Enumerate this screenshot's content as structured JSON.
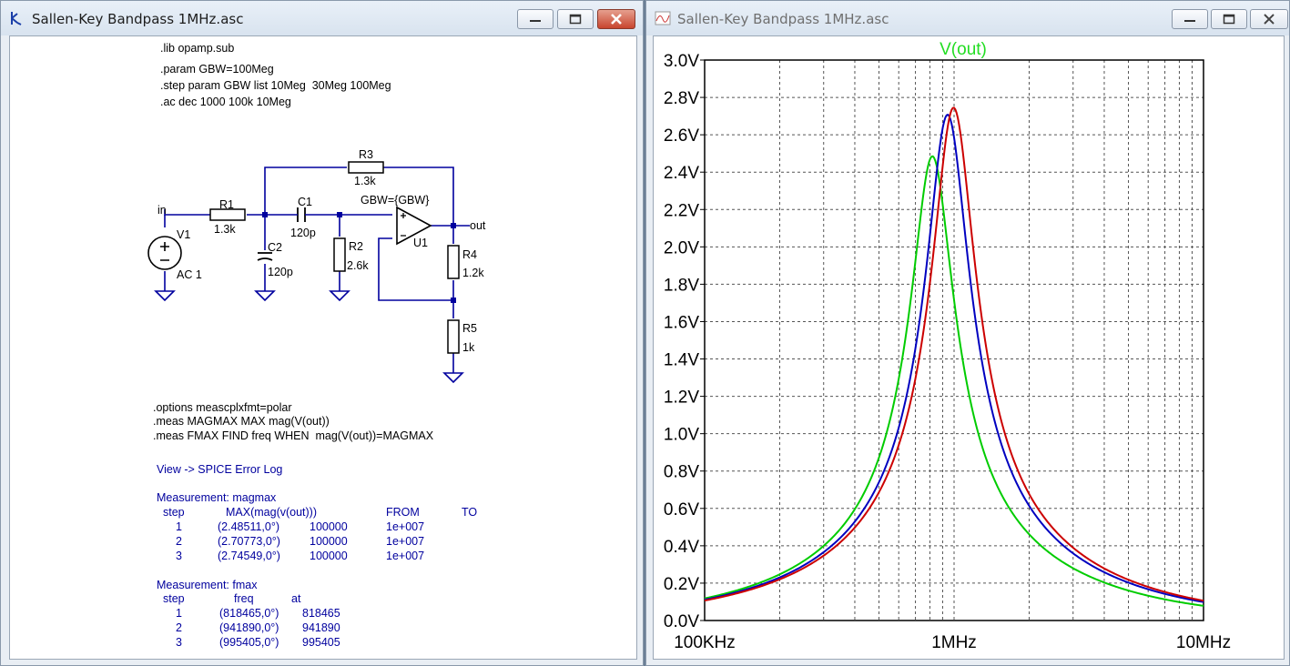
{
  "left_window": {
    "title": "Sallen-Key Bandpass 1MHz.asc",
    "directives": [
      ".lib opamp.sub",
      ".param GBW=100Meg",
      ".step param GBW list 10Meg  30Meg 100Meg",
      ".ac dec 1000 100k 10Meg"
    ],
    "components": {
      "r1_name": "R1",
      "r1_value": "1.3k",
      "r2_name": "R2",
      "r2_value": "2.6k",
      "r3_name": "R3",
      "r3_value": "1.3k",
      "r4_name": "R4",
      "r4_value": "1.2k",
      "r5_name": "R5",
      "r5_value": "1k",
      "c1_name": "C1",
      "c1_value": "120p",
      "c2_name": "C2",
      "c2_value": "120p",
      "v1_name": "V1",
      "v1_value": "AC 1",
      "u1_name": "U1",
      "u1_param": "GBW={GBW}",
      "in_label": "in",
      "out_label": "out"
    },
    "meas_directives": [
      ".options meascplxfmt=polar",
      ".meas MAGMAX MAX mag(V(out))",
      ".meas FMAX FIND freq WHEN  mag(V(out))=MAGMAX"
    ],
    "error_log_link": "View -> SPICE Error Log",
    "magmax": {
      "heading": "Measurement: magmax",
      "columns": [
        "step",
        "MAX(mag(v(out)))",
        "FROM",
        "TO"
      ],
      "rows": [
        [
          "1",
          "(2.48511,0°)",
          "100000",
          "1e+007"
        ],
        [
          "2",
          "(2.70773,0°)",
          "100000",
          "1e+007"
        ],
        [
          "3",
          "(2.74549,0°)",
          "100000",
          "1e+007"
        ]
      ]
    },
    "fmax": {
      "heading": "Measurement: fmax",
      "columns": [
        "step",
        "freq",
        "at"
      ],
      "rows": [
        [
          "1",
          "(818465,0°)",
          "818465"
        ],
        [
          "2",
          "(941890,0°)",
          "941890"
        ],
        [
          "3",
          "(995405,0°)",
          "995405"
        ]
      ]
    }
  },
  "right_window": {
    "title": "Sallen-Key Bandpass 1MHz.asc"
  },
  "chart_data": {
    "type": "line",
    "title": "V(out)",
    "xscale": "log",
    "xlim": [
      100000,
      10000000
    ],
    "ylim": [
      0,
      3.0
    ],
    "x_tick_labels": [
      "100KHz",
      "1MHz",
      "10MHz"
    ],
    "y_tick_labels": [
      "0.0V",
      "0.2V",
      "0.4V",
      "0.6V",
      "0.8V",
      "1.0V",
      "1.2V",
      "1.4V",
      "1.6V",
      "1.8V",
      "2.0V",
      "2.2V",
      "2.4V",
      "2.6V",
      "2.8V",
      "3.0V"
    ],
    "grid": true,
    "series": [
      {
        "color": "#00cc00",
        "peak_freq": 818465,
        "peak_mag": 2.48511
      },
      {
        "color": "#0000c0",
        "peak_freq": 941890,
        "peak_mag": 2.70773
      },
      {
        "color": "#cc0000",
        "peak_freq": 995405,
        "peak_mag": 2.74549
      }
    ]
  },
  "colors": {
    "title_green": "#22dd22",
    "wire": "#00009e",
    "measure_text": "#00009e"
  }
}
